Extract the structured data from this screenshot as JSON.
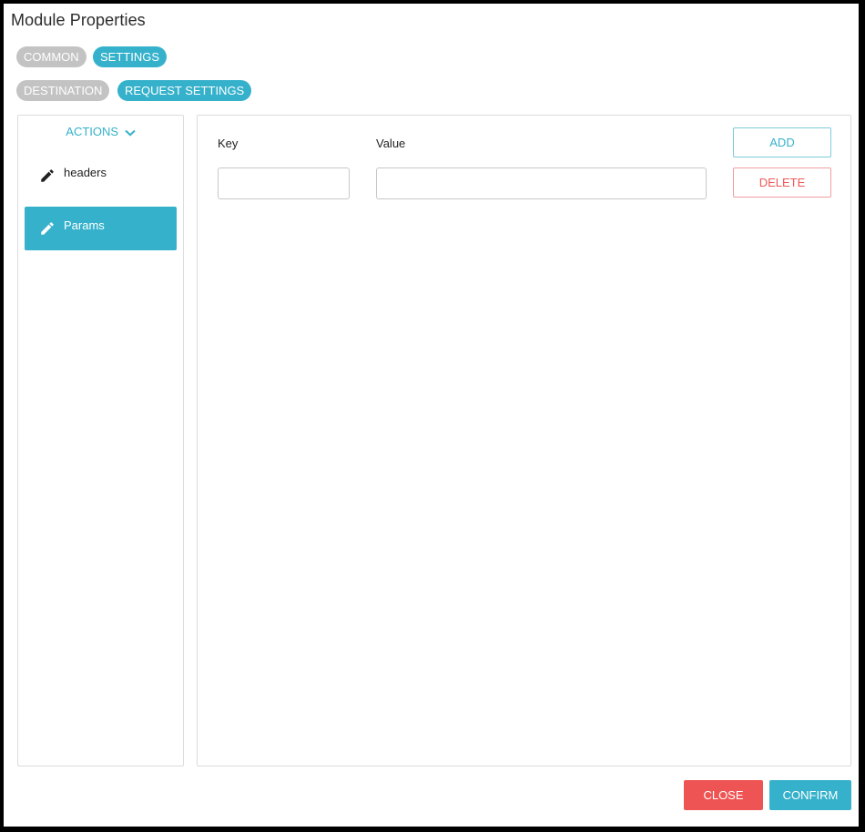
{
  "dialog": {
    "title": "Module Properties"
  },
  "tabs_row1": [
    {
      "label": "COMMON",
      "state": "inactive"
    },
    {
      "label": "SETTINGS",
      "state": "active"
    }
  ],
  "tabs_row2": [
    {
      "label": "DESTINATION",
      "state": "inactive"
    },
    {
      "label": "REQUEST SETTINGS",
      "state": "active"
    }
  ],
  "sidebar": {
    "actions_label": "ACTIONS",
    "actions_icon": "chevron-down-icon",
    "items": [
      {
        "label": "headers",
        "icon": "pencil-icon",
        "selected": false
      },
      {
        "label": "Params",
        "icon": "pencil-icon",
        "selected": true
      }
    ]
  },
  "editor": {
    "key_label": "Key",
    "value_label": "Value",
    "key_value": "",
    "value_value": "",
    "add_label": "ADD",
    "delete_label": "DELETE"
  },
  "footer": {
    "close_label": "CLOSE",
    "confirm_label": "CONFIRM"
  },
  "colors": {
    "accent": "#35b1cb",
    "inactive_pill": "#c3c3c3",
    "danger": "#ef5454"
  }
}
